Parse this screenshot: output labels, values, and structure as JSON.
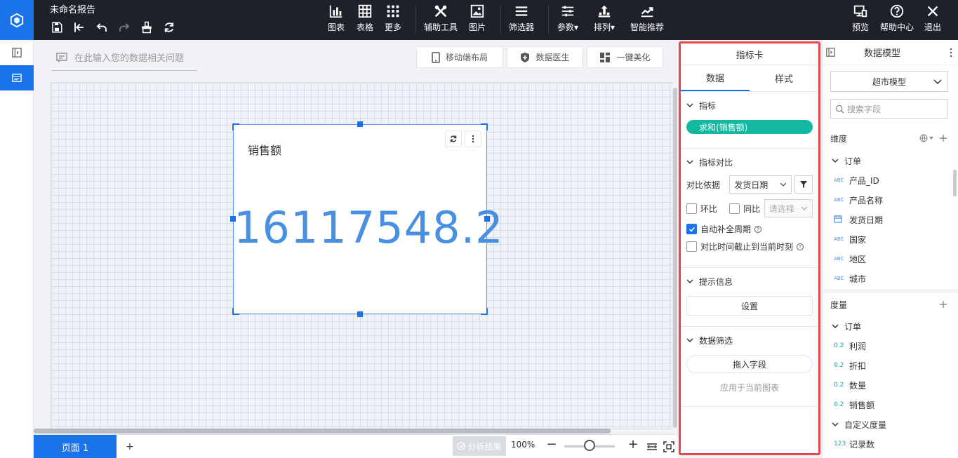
{
  "app": {
    "report_title": "未命名报告"
  },
  "toolbar": {
    "chart": "图表",
    "table": "表格",
    "more": "更多",
    "assist": "辅助工具",
    "image": "图片",
    "filter": "筛选器",
    "params": "参数",
    "arrange": "排列",
    "smart": "智能推荐",
    "preview": "预览",
    "help": "帮助中心",
    "exit": "退出"
  },
  "canvas": {
    "ask_placeholder": "在此输入您的数据相关问题",
    "mobile_layout": "移动端布局",
    "data_doctor": "数据医生",
    "beautify": "一键美化"
  },
  "widget": {
    "title": "销售额",
    "value": "16117548.2"
  },
  "bottom": {
    "page_tab": "页面 1",
    "add_page": "+",
    "analysis": "分析结果",
    "zoom_level": "100%",
    "zoom_fraction": 0.5
  },
  "config": {
    "title": "指标卡",
    "tab_data": "数据",
    "tab_style": "样式",
    "metric_section": "指标",
    "metric_pill": "求和(销售额)",
    "compare_section": "指标对比",
    "compare_basis_label": "对比依据",
    "compare_basis_value": "发货日期",
    "mom_label": "环比",
    "yoy_label": "同比",
    "yoy_select_placeholder": "请选择",
    "auto_fill_label": "自动补全周期",
    "auto_fill_checked": true,
    "cutoff_label": "对比时间截止到当前时刻",
    "tooltip_section": "提示信息",
    "tooltip_button": "设置",
    "filter_section": "数据筛选",
    "drag_field": "拖入字段",
    "apply_note": "应用于当前图表"
  },
  "model": {
    "title": "数据模型",
    "model_select": "超市模型",
    "search_placeholder": "搜索字段",
    "dim_header": "维度",
    "dim_group": "订单",
    "dim_fields": [
      {
        "tag": "ABC",
        "name": "产品_ID"
      },
      {
        "tag": "ABC",
        "name": "产品名称"
      },
      {
        "tag": "date",
        "name": "发货日期"
      },
      {
        "tag": "ABC",
        "name": "国家"
      },
      {
        "tag": "ABC",
        "name": "地区"
      },
      {
        "tag": "ABC",
        "name": "城市"
      }
    ],
    "measure_header": "度量",
    "measure_group": "订单",
    "measure_fields": [
      {
        "tag": "0.2",
        "name": "利润"
      },
      {
        "tag": "0.2",
        "name": "折扣"
      },
      {
        "tag": "0.2",
        "name": "数量"
      },
      {
        "tag": "0.2",
        "name": "销售额"
      }
    ],
    "custom_group": "自定义度量",
    "custom_fields": [
      {
        "tag": "123",
        "name": "记录数"
      }
    ]
  }
}
